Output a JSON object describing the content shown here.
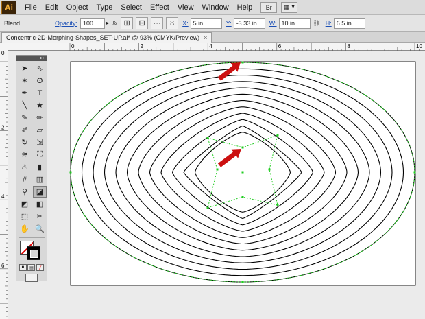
{
  "app": {
    "logo": "Ai"
  },
  "menubar": {
    "items": [
      "File",
      "Edit",
      "Object",
      "Type",
      "Select",
      "Effect",
      "View",
      "Window",
      "Help"
    ],
    "bridge_label": "Br"
  },
  "controlbar": {
    "object_type": "Blend",
    "opacity_label": "Opacity:",
    "opacity_value": "100",
    "percent": "%",
    "x_label": "X:",
    "x_value": "5 in",
    "y_label": "Y:",
    "y_value": "-3.33 in",
    "w_label": "W:",
    "w_value": "10 in",
    "h_label": "H:",
    "h_value": "6.5 in"
  },
  "document_tab": {
    "title": "Concentric-2D-Morphing-Shapes_SET-UP.ai* @ 93% (CMYK/Preview)",
    "close": "×"
  },
  "rulers": {
    "horizontal": [
      "0",
      "2",
      "4",
      "6",
      "8",
      "10"
    ],
    "horizontal_origin": "0",
    "vertical": [
      "2",
      "4",
      "6"
    ],
    "vertical_origin": "0"
  },
  "artwork": {
    "rings": 12,
    "stroke_color": "#000000",
    "selection_color": "#22cc22",
    "arrow_color": "#cc1111",
    "artboard_color": "#ffffff"
  },
  "tools": {
    "icons": [
      "selection-icon",
      "direct-selection-icon",
      "magic-wand-icon",
      "lasso-icon",
      "pen-icon",
      "type-icon",
      "line-icon",
      "star-icon",
      "paintbrush-icon",
      "pencil-icon",
      "blob-brush-icon",
      "eraser-icon",
      "rotate-icon",
      "scale-icon",
      "warp-icon",
      "free-transform-icon",
      "symbol-sprayer-icon",
      "column-graph-icon",
      "mesh-icon",
      "gradient-icon",
      "eyedropper-icon",
      "blend-icon",
      "live-paint-icon",
      "live-paint-selection-icon",
      "artboard-icon",
      "slice-icon",
      "hand-icon",
      "zoom-icon"
    ],
    "glyphs": [
      "➤",
      "⇖",
      "✶",
      "ʘ",
      "✒",
      "T",
      "╲",
      "★",
      "✎",
      "✏",
      "✐",
      "▱",
      "↻",
      "⇲",
      "≋",
      "⛶",
      "♨",
      "▮",
      "#",
      "▥",
      "⚲",
      "◪",
      "◩",
      "◧",
      "⬚",
      "✂",
      "✋",
      "🔍"
    ],
    "selected": "blend-icon"
  }
}
